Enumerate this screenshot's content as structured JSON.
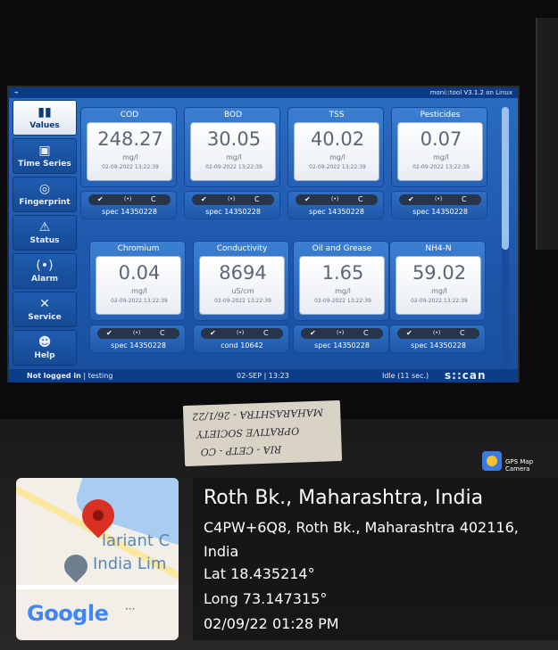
{
  "window": {
    "title": "moni::tool V3.1.2 on Linux"
  },
  "sidebar": {
    "items": [
      {
        "label": "Values",
        "icon": "bar-chart-icon",
        "active": true
      },
      {
        "label": "Time Series",
        "icon": "monitor-icon",
        "active": false
      },
      {
        "label": "Fingerprint",
        "icon": "fingerprint-icon",
        "active": false
      },
      {
        "label": "Status",
        "icon": "warning-icon",
        "active": false
      },
      {
        "label": "Alarm",
        "icon": "alarm-icon",
        "active": false
      },
      {
        "label": "Service",
        "icon": "tools-icon",
        "active": false
      },
      {
        "label": "Help",
        "icon": "help-icon",
        "active": false
      }
    ]
  },
  "tiles": [
    {
      "name": "COD",
      "value": "248.27",
      "unit": "mg/l",
      "timestamp": "02-09-2022 13:22:39",
      "sensor": "spec 14350228"
    },
    {
      "name": "BOD",
      "value": "30.05",
      "unit": "mg/l",
      "timestamp": "02-09-2022 13:22:39",
      "sensor": "spec 14350228"
    },
    {
      "name": "TSS",
      "value": "40.02",
      "unit": "mg/l",
      "timestamp": "02-09-2022 13:22:39",
      "sensor": "spec 14350228"
    },
    {
      "name": "Pesticides",
      "value": "0.07",
      "unit": "mg/l",
      "timestamp": "02-09-2022 13:22:39",
      "sensor": "spec 14350228"
    },
    {
      "name": "Chromium",
      "value": "0.04",
      "unit": "mg/l",
      "timestamp": "02-09-2022 13:22:39",
      "sensor": "spec 14350228"
    },
    {
      "name": "Conductivity",
      "value": "8694",
      "unit": "uS/cm",
      "timestamp": "02-09-2022 13:22:39",
      "sensor": "cond 10642"
    },
    {
      "name": "Oil and Grease",
      "value": "1.65",
      "unit": "mg/l",
      "timestamp": "02-09-2022 13:22:39",
      "sensor": "spec 14350228"
    },
    {
      "name": "NH4-N",
      "value": "59.02",
      "unit": "mg/l",
      "timestamp": "02-09-2022 13:22:39",
      "sensor": "spec 14350228"
    }
  ],
  "controls": {
    "ok": "✔",
    "mid": "(•)",
    "cal": "C"
  },
  "statusbar": {
    "user": "Not logged in",
    "mode": "| testing",
    "datetime": "02-SEP | 13:23",
    "idle": "Idle (11 sec.)",
    "brand": "s::can"
  },
  "note": {
    "line1": "MAHARASHTRA - 26/1/22",
    "line2": "OPRATIVE SOCIETY",
    "line3": "RIA - CETP - CO"
  },
  "gps": {
    "app_label": "GPS Map Camera",
    "map_text1": "lariant C",
    "map_text2": "India Lim",
    "map_brand": "Google",
    "map_dots": "···",
    "place": "Roth Bk., Maharashtra, India",
    "address": "C4PW+6Q8, Roth Bk., Maharashtra 402116, India",
    "lat": "Lat 18.435214°",
    "long": "Long 73.147315°",
    "datetime": "02/09/22 01:28 PM"
  },
  "colors": {
    "screen_bg": "#1b55a8",
    "tile_box": "#ffffff",
    "status_bar": "#0d3c88"
  }
}
